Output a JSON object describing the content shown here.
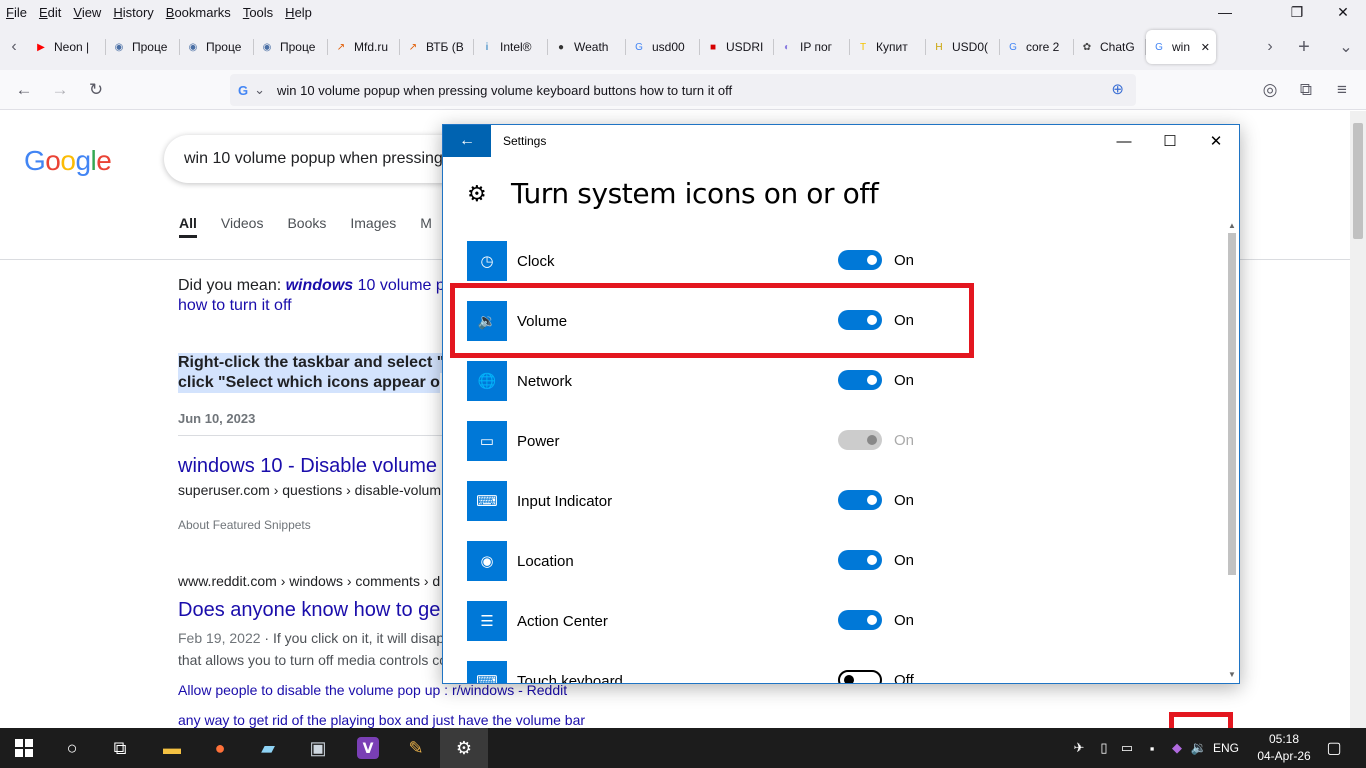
{
  "menubar": {
    "items": [
      "File",
      "Edit",
      "View",
      "History",
      "Bookmarks",
      "Tools",
      "Help"
    ],
    "underline": [
      "F",
      "E",
      "V",
      "H",
      "B",
      "T",
      "H"
    ],
    "rest": [
      "ile",
      "dit",
      "iew",
      "istory",
      "ookmarks",
      "ools",
      "elp"
    ]
  },
  "tabs": [
    {
      "title": "Neon |",
      "icon": "▶",
      "color": "#ff0000"
    },
    {
      "title": "Проце",
      "icon": "◉",
      "color": "#4a6fa5"
    },
    {
      "title": "Проце",
      "icon": "◉",
      "color": "#4a6fa5"
    },
    {
      "title": "Проце",
      "icon": "◉",
      "color": "#4a6fa5"
    },
    {
      "title": "Mfd.ru",
      "icon": "↗",
      "color": "#e05a00"
    },
    {
      "title": "ВТБ (В",
      "icon": "↗",
      "color": "#e05a00"
    },
    {
      "title": "Intel®",
      "icon": "i",
      "color": "#0068b5"
    },
    {
      "title": "Weath",
      "icon": "●",
      "color": "#333333"
    },
    {
      "title": "usd00",
      "icon": "G",
      "color": "#4285f4"
    },
    {
      "title": "USDRI",
      "icon": "■",
      "color": "#d50000"
    },
    {
      "title": "IP пог",
      "icon": "◐",
      "color": "#8a7ce0"
    },
    {
      "title": "Купит",
      "icon": "T",
      "color": "#f5c400"
    },
    {
      "title": "USD0(",
      "icon": "H",
      "color": "#c9a200"
    },
    {
      "title": "core 2",
      "icon": "G",
      "color": "#4285f4"
    },
    {
      "title": "ChatG",
      "icon": "✿",
      "color": "#444444"
    },
    {
      "title": "win",
      "icon": "G",
      "color": "#4285f4"
    }
  ],
  "address": {
    "engine": "G",
    "url": "win 10 volume popup when pressing volume keyboard buttons how to turn it off"
  },
  "google": {
    "logo": "Google",
    "query": "win 10 volume popup when pressing",
    "tabs": [
      "All",
      "Videos",
      "Books",
      "Images",
      "M"
    ],
    "dym_prefix": "Did you mean: ",
    "dym_bold": "windows",
    "dym_rest": " 10 volume p",
    "dym_line2": "how to turn it off",
    "snippet_line1": "Right-click the taskbar and select \"",
    "snippet_line2": "click \"Select which icons appear o",
    "date": "Jun 10, 2023",
    "result1_title": "windows 10 - Disable volume",
    "result1_url": "superuser.com › questions › disable-volum",
    "about": "About Featured Snippets",
    "result2_url": "www.reddit.com › windows › comments › d",
    "result2_title": "Does anyone know how to ge",
    "result2_date": "Feb 19, 2022",
    "result2_snip1": " · If you click on it, it will disap",
    "result2_snip2": "that allows you to turn off media controls co",
    "sub1": "Allow people to disable the volume pop up : r/windows - Reddit",
    "sub2": "any way to get rid of the playing box and just have the volume bar"
  },
  "settings": {
    "app_title": "Settings",
    "heading": "Turn system icons on or off",
    "rows": [
      {
        "label": "Clock",
        "state": "On",
        "icon": "◷",
        "mode": "on"
      },
      {
        "label": "Volume",
        "state": "On",
        "icon": "🔉",
        "mode": "on"
      },
      {
        "label": "Network",
        "state": "On",
        "icon": "🌐",
        "mode": "on"
      },
      {
        "label": "Power",
        "state": "On",
        "icon": "▭",
        "mode": "disabled"
      },
      {
        "label": "Input Indicator",
        "state": "On",
        "icon": "⌨",
        "mode": "on"
      },
      {
        "label": "Location",
        "state": "On",
        "icon": "◉",
        "mode": "on"
      },
      {
        "label": "Action Center",
        "state": "On",
        "icon": "☰",
        "mode": "on"
      },
      {
        "label": "Touch keyboard",
        "state": "Off",
        "icon": "⌨",
        "mode": "off"
      }
    ]
  },
  "taskbar": {
    "lang": "ENG",
    "time": "05:18",
    "date": "04-Apr-26"
  }
}
